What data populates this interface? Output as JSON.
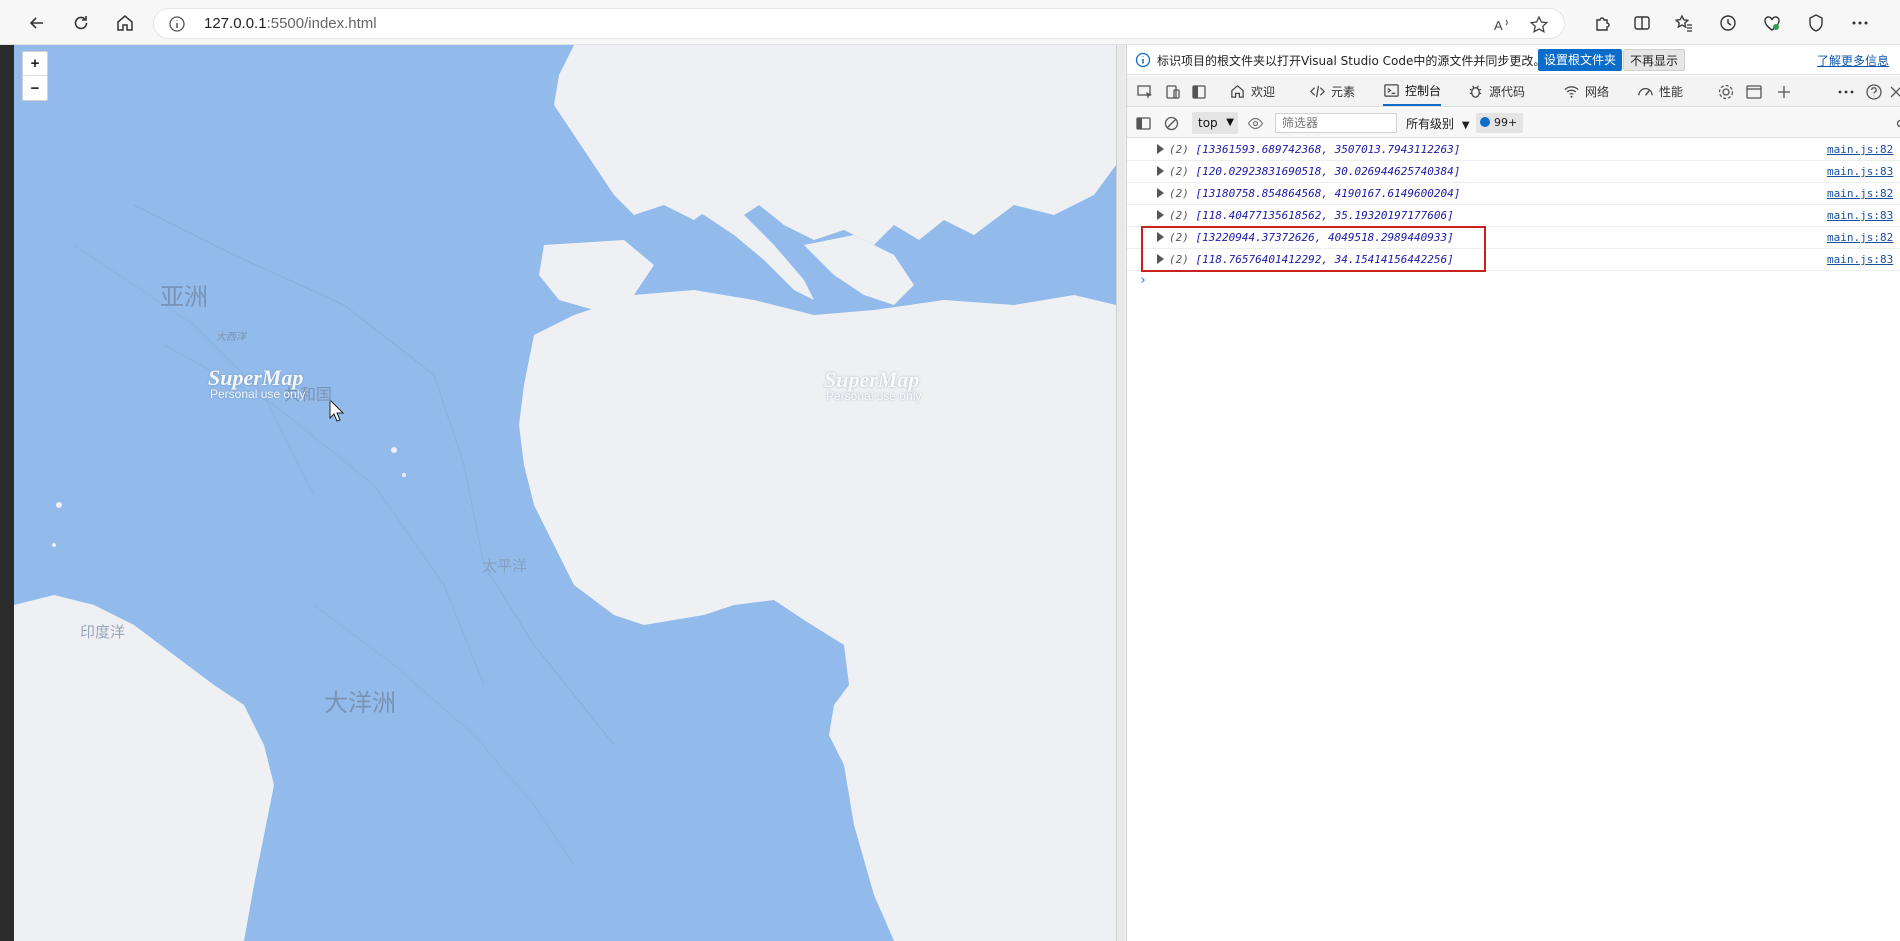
{
  "browser": {
    "url_host": "127.0.0.1",
    "url_rest": ":5500/index.html"
  },
  "map": {
    "labels": {
      "asia": "亚洲",
      "atlantic_small": "大西洋",
      "republic": "共和国",
      "pacific": "太平洋",
      "indian": "印度洋",
      "oceania": "大洋洲"
    },
    "watermark": {
      "brand": "SuperMap",
      "sub": "Personal use only"
    },
    "zoom_in": "+",
    "zoom_out": "−",
    "colors": {
      "water": "#92bbeb",
      "land": "#eef0f3"
    }
  },
  "devtools": {
    "infobar": {
      "text": "标识项目的根文件夹以打开Visual Studio Code中的源文件并同步更改。",
      "set_root": "设置根文件夹",
      "dont_show": "不再显示",
      "learn_more": "了解更多信息"
    },
    "tabs": [
      {
        "label": "欢迎"
      },
      {
        "label": "元素"
      },
      {
        "label": "控制台"
      },
      {
        "label": "源代码"
      },
      {
        "label": "网络"
      },
      {
        "label": "性能"
      }
    ],
    "filterbar": {
      "context": "top",
      "filter_placeholder": "筛选器",
      "levels": "所有级别",
      "issues": "99+"
    },
    "console": {
      "rows": [
        {
          "count": "(2)",
          "value": "[13361593.689742368, 3507013.7943112263]",
          "source": "main.js:82"
        },
        {
          "count": "(2)",
          "value": "[120.02923831690518, 30.026944625740384]",
          "source": "main.js:83"
        },
        {
          "count": "(2)",
          "value": "[13180758.854864568, 4190167.6149600204]",
          "source": "main.js:82"
        },
        {
          "count": "(2)",
          "value": "[118.40477135618562, 35.19320197177606]",
          "source": "main.js:83"
        },
        {
          "count": "(2)",
          "value": "[13220944.37372626, 4049518.2989440933]",
          "source": "main.js:82"
        },
        {
          "count": "(2)",
          "value": "[118.76576401412292, 34.15414156442256]",
          "source": "main.js:83"
        }
      ],
      "prompt": "›"
    }
  }
}
